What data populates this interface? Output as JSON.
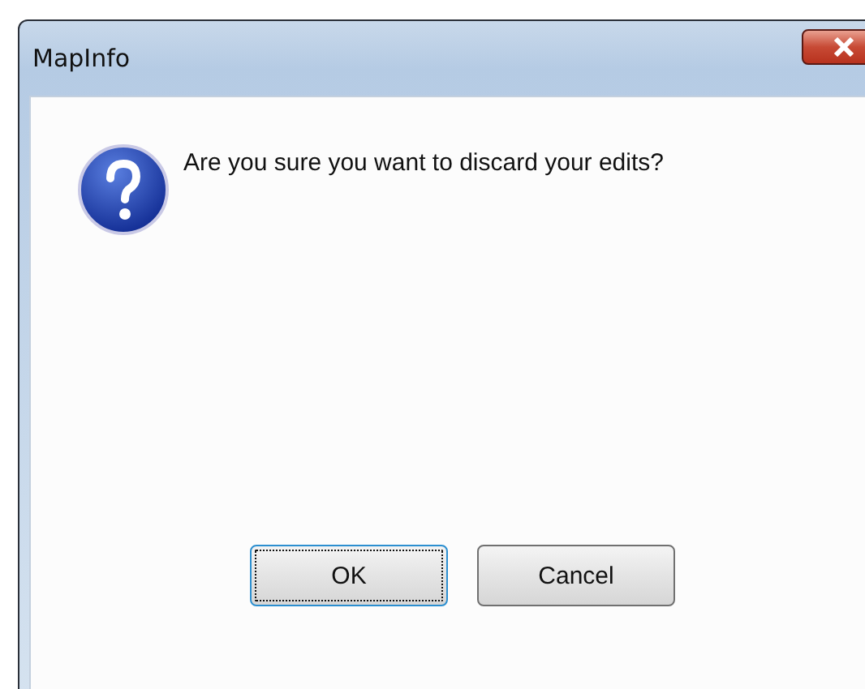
{
  "window": {
    "title": "MapInfo"
  },
  "message": "Are you sure you want to discard your edits?",
  "buttons": [
    {
      "label": "OK",
      "default": true
    },
    {
      "label": "Cancel",
      "default": false
    }
  ]
}
